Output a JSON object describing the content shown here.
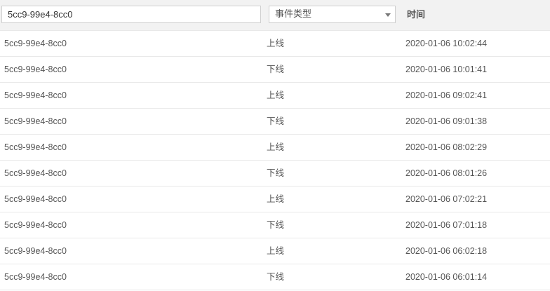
{
  "filters": {
    "device_search_value": "5cc9-99e4-8cc0",
    "event_type_selected": "事件类型",
    "time_header": "时间"
  },
  "rows": [
    {
      "device": "5cc9-99e4-8cc0",
      "event": "上线",
      "time": "2020-01-06 10:02:44"
    },
    {
      "device": "5cc9-99e4-8cc0",
      "event": "下线",
      "time": "2020-01-06 10:01:41"
    },
    {
      "device": "5cc9-99e4-8cc0",
      "event": "上线",
      "time": "2020-01-06 09:02:41"
    },
    {
      "device": "5cc9-99e4-8cc0",
      "event": "下线",
      "time": "2020-01-06 09:01:38"
    },
    {
      "device": "5cc9-99e4-8cc0",
      "event": "上线",
      "time": "2020-01-06 08:02:29"
    },
    {
      "device": "5cc9-99e4-8cc0",
      "event": "下线",
      "time": "2020-01-06 08:01:26"
    },
    {
      "device": "5cc9-99e4-8cc0",
      "event": "上线",
      "time": "2020-01-06 07:02:21"
    },
    {
      "device": "5cc9-99e4-8cc0",
      "event": "下线",
      "time": "2020-01-06 07:01:18"
    },
    {
      "device": "5cc9-99e4-8cc0",
      "event": "上线",
      "time": "2020-01-06 06:02:18"
    },
    {
      "device": "5cc9-99e4-8cc0",
      "event": "下线",
      "time": "2020-01-06 06:01:14"
    }
  ]
}
